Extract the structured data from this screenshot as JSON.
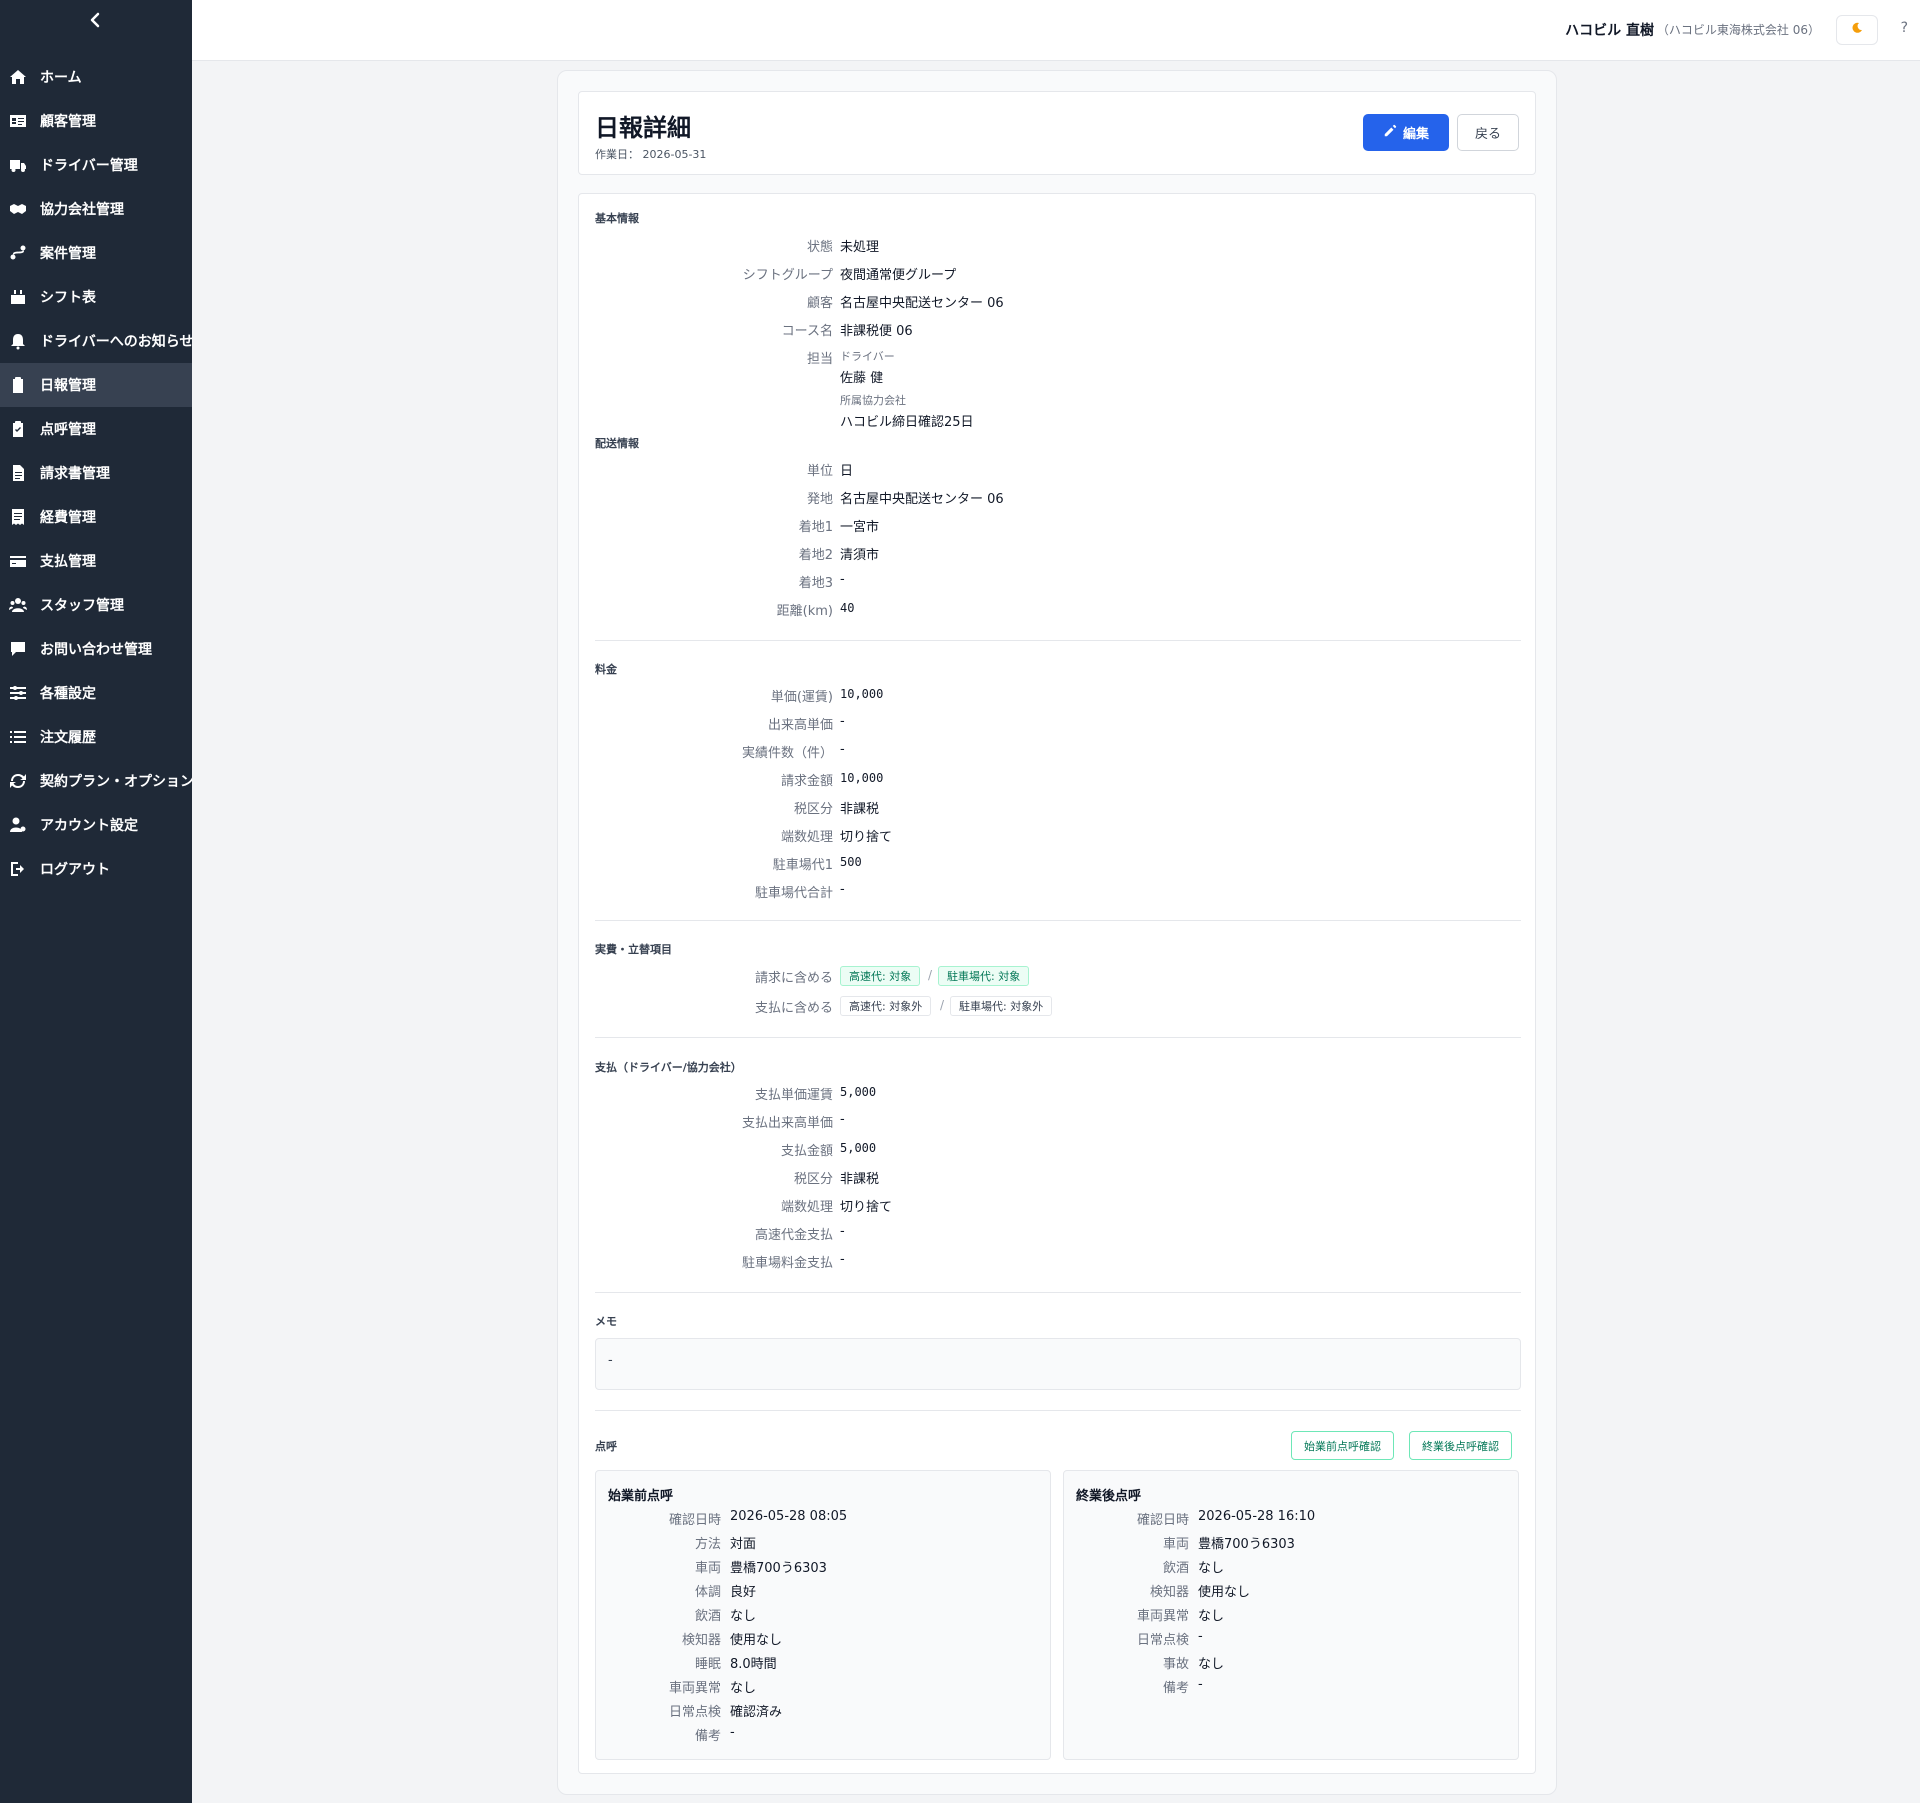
{
  "sidebar": {
    "collapse_icon": "chevron-left-icon",
    "items": [
      {
        "label": "ホーム",
        "icon": "home-icon"
      },
      {
        "label": "顧客管理",
        "icon": "id-card-icon"
      },
      {
        "label": "ドライバー管理",
        "icon": "truck-icon"
      },
      {
        "label": "協力会社管理",
        "icon": "handshake-icon"
      },
      {
        "label": "案件管理",
        "icon": "route-icon"
      },
      {
        "label": "シフト表",
        "icon": "calendar-icon"
      },
      {
        "label": "ドライバーへのお知らせ",
        "icon": "bell-icon"
      },
      {
        "label": "日報管理",
        "icon": "clipboard-icon",
        "active": true
      },
      {
        "label": "点呼管理",
        "icon": "clipboard-check-icon"
      },
      {
        "label": "請求書管理",
        "icon": "file-icon"
      },
      {
        "label": "経費管理",
        "icon": "receipt-icon"
      },
      {
        "label": "支払管理",
        "icon": "credit-card-icon"
      },
      {
        "label": "スタッフ管理",
        "icon": "users-icon"
      },
      {
        "label": "お問い合わせ管理",
        "icon": "message-icon"
      },
      {
        "label": "各種設定",
        "icon": "sliders-icon"
      },
      {
        "label": "注文履歴",
        "icon": "list-icon"
      },
      {
        "label": "契約プラン・オプション",
        "icon": "refresh-icon"
      },
      {
        "label": "アカウント設定",
        "icon": "user-gear-icon"
      },
      {
        "label": "ログアウト",
        "icon": "logout-icon"
      }
    ]
  },
  "header": {
    "user_name": "ハコビル 直樹",
    "company": "（ハコビル東海株式会社 06）",
    "theme_icon": "moon-icon",
    "help": "?"
  },
  "page": {
    "title": "日報詳細",
    "work_date": "作業日： 2026-05-31",
    "edit_label": "編集",
    "back_label": "戻る"
  },
  "basic": {
    "title": "基本情報",
    "status_label": "状態",
    "status": "未処理",
    "shift_group_label": "シフトグループ",
    "shift_group": "夜間通常便グループ",
    "customer_label": "顧客",
    "customer": "名古屋中央配送センター 06",
    "course_label": "コース名",
    "course": "非課税便 06",
    "assignee_label": "担当",
    "driver_label": "ドライバー",
    "driver": "佐藤 健",
    "partner_label": "所属協力会社",
    "partner": "ハコビル締日確認25日"
  },
  "delivery": {
    "title": "配送情報",
    "unit_label": "単位",
    "unit": "日",
    "origin_label": "発地",
    "origin": "名古屋中央配送センター 06",
    "dest1_label": "着地1",
    "dest1": "一宮市",
    "dest2_label": "着地2",
    "dest2": "清須市",
    "dest3_label": "着地3",
    "dest3": "-",
    "distance_label": "距離(km)",
    "distance": "40"
  },
  "fee": {
    "title": "料金",
    "unit_price_label": "単価(運賃)",
    "unit_price": "10,000",
    "piece_price_label": "出来高単価",
    "piece_price": "-",
    "count_label": "実績件数（件）",
    "count": "-",
    "billing_label": "請求金額",
    "billing": "10,000",
    "tax_label": "税区分",
    "tax": "非課税",
    "rounding_label": "端数処理",
    "rounding": "切り捨て",
    "parking1_label": "駐車場代1",
    "parking1": "500",
    "parking_total_label": "駐車場代合計",
    "parking_total": "-"
  },
  "expense": {
    "title": "実費・立替項目",
    "billing_label": "請求に含める",
    "billing_highway": "高速代: 対象",
    "billing_parking": "駐車場代: 対象",
    "payment_label": "支払に含める",
    "payment_highway": "高速代: 対象外",
    "payment_parking": "駐車場代: 対象外",
    "sep": "/"
  },
  "payment": {
    "title": "支払（ドライバー/協力会社）",
    "unit_price_label": "支払単価運賃",
    "unit_price": "5,000",
    "piece_price_label": "支払出来高単価",
    "piece_price": "-",
    "amount_label": "支払金額",
    "amount": "5,000",
    "tax_label": "税区分",
    "tax": "非課税",
    "rounding_label": "端数処理",
    "rounding": "切り捨て",
    "highway_label": "高速代金支払",
    "highway": "-",
    "parking_label": "駐車場料金支払",
    "parking": "-"
  },
  "memo": {
    "title": "メモ",
    "value": "-"
  },
  "roll_call": {
    "title": "点呼",
    "pre_button": "始業前点呼確認",
    "post_button": "終業後点呼確認",
    "pre": {
      "title": "始業前点呼",
      "rows": [
        {
          "label": "確認日時",
          "value": "2026-05-28 08:05"
        },
        {
          "label": "方法",
          "value": "対面"
        },
        {
          "label": "車両",
          "value": "豊橋700う6303"
        },
        {
          "label": "体調",
          "value": "良好"
        },
        {
          "label": "飲酒",
          "value": "なし"
        },
        {
          "label": "検知器",
          "value": "使用なし"
        },
        {
          "label": "睡眠",
          "value": "8.0時間"
        },
        {
          "label": "車両異常",
          "value": "なし"
        },
        {
          "label": "日常点検",
          "value": "確認済み"
        },
        {
          "label": "備考",
          "value": "-"
        }
      ]
    },
    "post": {
      "title": "終業後点呼",
      "rows": [
        {
          "label": "確認日時",
          "value": "2026-05-28 16:10"
        },
        {
          "label": "車両",
          "value": "豊橋700う6303"
        },
        {
          "label": "飲酒",
          "value": "なし"
        },
        {
          "label": "検知器",
          "value": "使用なし"
        },
        {
          "label": "車両異常",
          "value": "なし"
        },
        {
          "label": "日常点検",
          "value": "-"
        },
        {
          "label": "事故",
          "value": "なし"
        },
        {
          "label": "備考",
          "value": "-"
        }
      ]
    }
  }
}
